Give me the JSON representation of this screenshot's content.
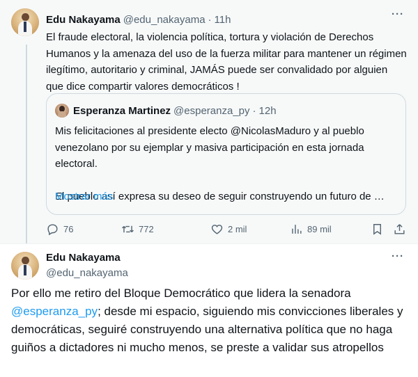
{
  "tweet1": {
    "author_name": "Edu Nakayama",
    "author_handle": "@edu_nakayama",
    "separator": "·",
    "time": "11h",
    "more_icon": "more-horizontal-icon",
    "text": "El fraude electoral, la violencia política, tortura y violación de Derechos Humanos y la amenaza del uso de la fuerza militar para mantener un régimen ilegítimo, autoritario y criminal, JAMÁS puede ser convalidado por alguien que dice compartir valores democráticos !",
    "quote": {
      "author_name": "Esperanza Martinez",
      "author_handle": "@esperanza_py",
      "separator": "·",
      "time": "12h",
      "paragraph1": "Mis felicitaciones al presidente electo @NicolasMaduro y al pueblo venezolano por su ejemplar y masiva participación en esta jornada electoral.",
      "paragraph2": "El pueblo así expresa su deseo de seguir construyendo un futuro de …",
      "show_more": "Mostrar más"
    },
    "actions": {
      "replies": "76",
      "reposts": "772",
      "likes": "2 mil",
      "views": "89 mil"
    }
  },
  "tweet2": {
    "author_name": "Edu Nakayama",
    "author_handle": "@edu_nakayama",
    "more_icon": "more-horizontal-icon",
    "text_before": "Por ello me retiro del Bloque Democrático que lidera la senadora ",
    "mention": "@esperanza_py",
    "text_after": "; desde mi espacio, siguiendo mis convicciones liberales y democráticas, seguiré construyendo una alternativa política que no haga guiños a dictadores ni mucho menos, se preste a validar sus atropellos"
  },
  "colors": {
    "link": "#1d9bf0",
    "secondary_text": "#536471",
    "primary_text": "#0f1419",
    "highlight_bg": "#f7f9f9",
    "border": "#cfd9de"
  }
}
